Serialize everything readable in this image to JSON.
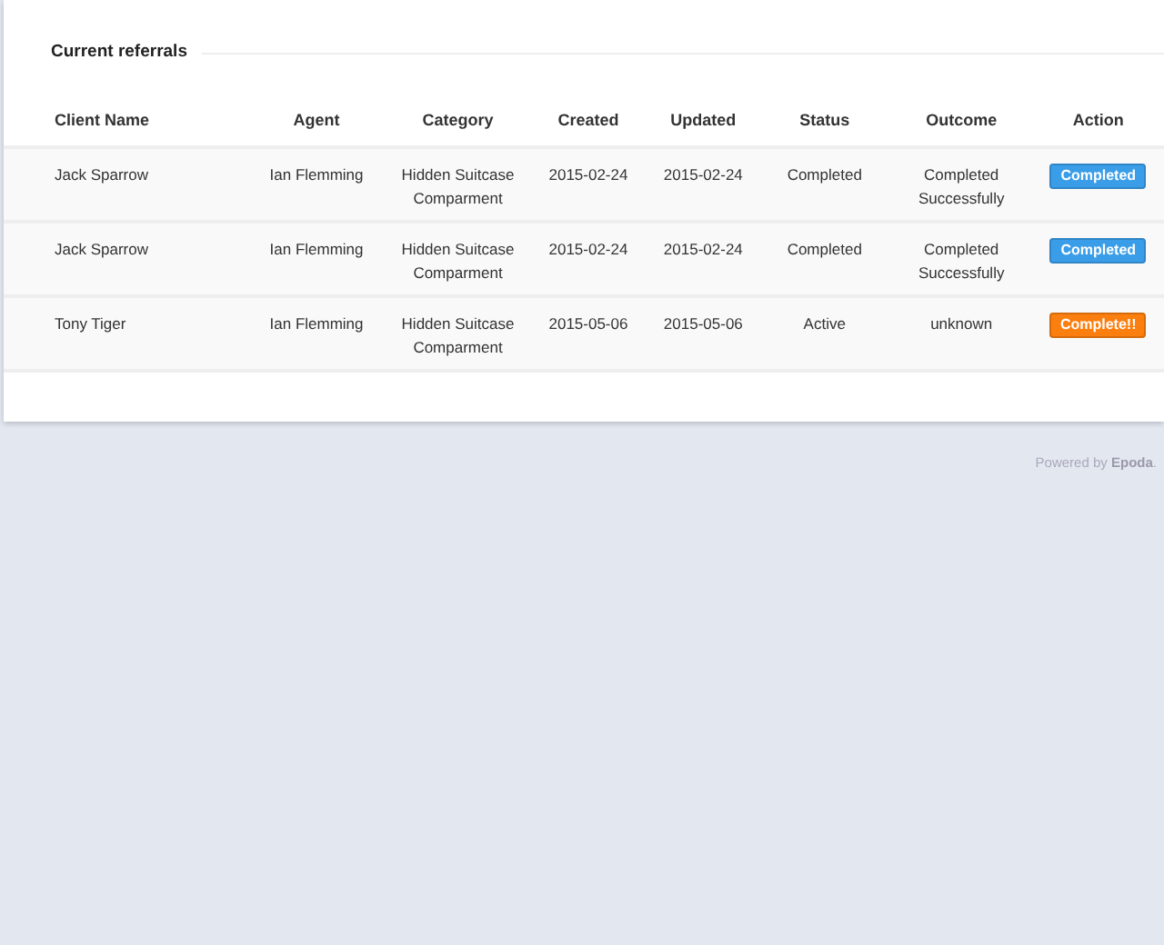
{
  "panel": {
    "title": "Current referrals"
  },
  "table": {
    "columns": [
      "Client Name",
      "Agent",
      "Category",
      "Created",
      "Updated",
      "Status",
      "Outcome",
      "Action"
    ],
    "rows": [
      {
        "cells": [
          "Jack Sparrow",
          "Ian Flemming",
          "Hidden Suitcase Comparment",
          "2015-02-24",
          "2015-02-24",
          "Completed",
          "Completed Successfully"
        ],
        "action": {
          "label": "Completed",
          "color": "#3a9de8"
        }
      },
      {
        "cells": [
          "Jack Sparrow",
          "Ian Flemming",
          "Hidden Suitcase Comparment",
          "2015-02-24",
          "2015-02-24",
          "Completed",
          "Completed Successfully"
        ],
        "action": {
          "label": "Completed",
          "color": "#3a9de8"
        }
      },
      {
        "cells": [
          "Tony Tiger",
          "Ian Flemming",
          "Hidden Suitcase Comparment",
          "2015-05-06",
          "2015-05-06",
          "Active",
          "unknown"
        ],
        "action": {
          "label": "Complete!!",
          "color": "#fb7f0f"
        }
      }
    ]
  },
  "footer": "Powered by **Epoda**."
}
